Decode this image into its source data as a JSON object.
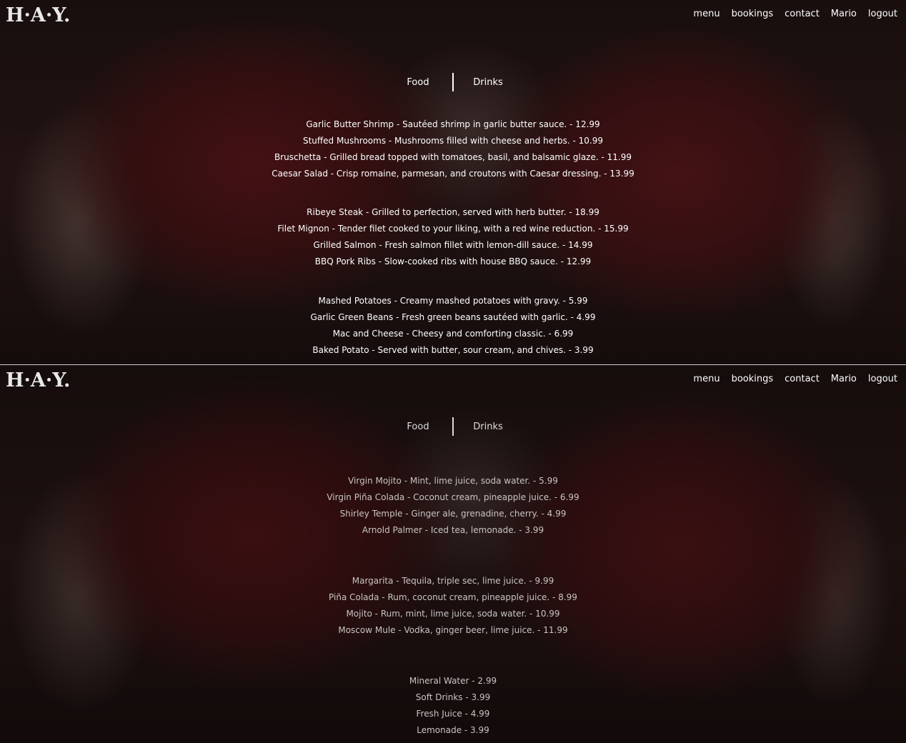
{
  "brand": {
    "logo": "H·A·Y."
  },
  "nav": {
    "menu": "menu",
    "bookings": "bookings",
    "contact": "contact",
    "user": "Mario",
    "logout": "logout"
  },
  "tabs": {
    "food": "Food",
    "drinks": "Drinks"
  },
  "food": {
    "starters": [
      "Garlic Butter Shrimp - Sautéed shrimp in garlic butter sauce. - 12.99",
      "Stuffed Mushrooms - Mushrooms filled with cheese and herbs. - 10.99",
      "Bruschetta - Grilled bread topped with tomatoes, basil, and balsamic glaze. - 11.99",
      "Caesar Salad - Crisp romaine, parmesan, and croutons with Caesar dressing. - 13.99"
    ],
    "mains": [
      "Ribeye Steak - Grilled to perfection, served with herb butter. - 18.99",
      "Filet Mignon - Tender filet cooked to your liking, with a red wine reduction. - 15.99",
      "Grilled Salmon - Fresh salmon fillet with lemon-dill sauce. - 14.99",
      "BBQ Pork Ribs - Slow-cooked ribs with house BBQ sauce. - 12.99"
    ],
    "sides": [
      "Mashed Potatoes - Creamy mashed potatoes with gravy. - 5.99",
      "Garlic Green Beans - Fresh green beans sautéed with garlic. - 4.99",
      "Mac and Cheese - Cheesy and comforting classic. - 6.99",
      "Baked Potato - Served with butter, sour cream, and chives. - 3.99"
    ]
  },
  "drinks": {
    "mocktails": [
      "Virgin Mojito - Mint, lime juice, soda water. - 5.99",
      "Virgin Piña Colada - Coconut cream, pineapple juice. - 6.99",
      "Shirley Temple - Ginger ale, grenadine, cherry. - 4.99",
      "Arnold Palmer - Iced tea, lemonade. - 3.99"
    ],
    "cocktails": [
      "Margarita - Tequila, triple sec, lime juice. - 9.99",
      "Piña Colada - Rum, coconut cream, pineapple juice. - 8.99",
      "Mojito - Rum, mint, lime juice, soda water. - 10.99",
      "Moscow Mule - Vodka, ginger beer, lime juice. - 11.99"
    ],
    "soft": [
      "Mineral Water - 2.99",
      "Soft Drinks - 3.99",
      "Fresh Juice - 4.99",
      "Lemonade - 3.99"
    ]
  }
}
